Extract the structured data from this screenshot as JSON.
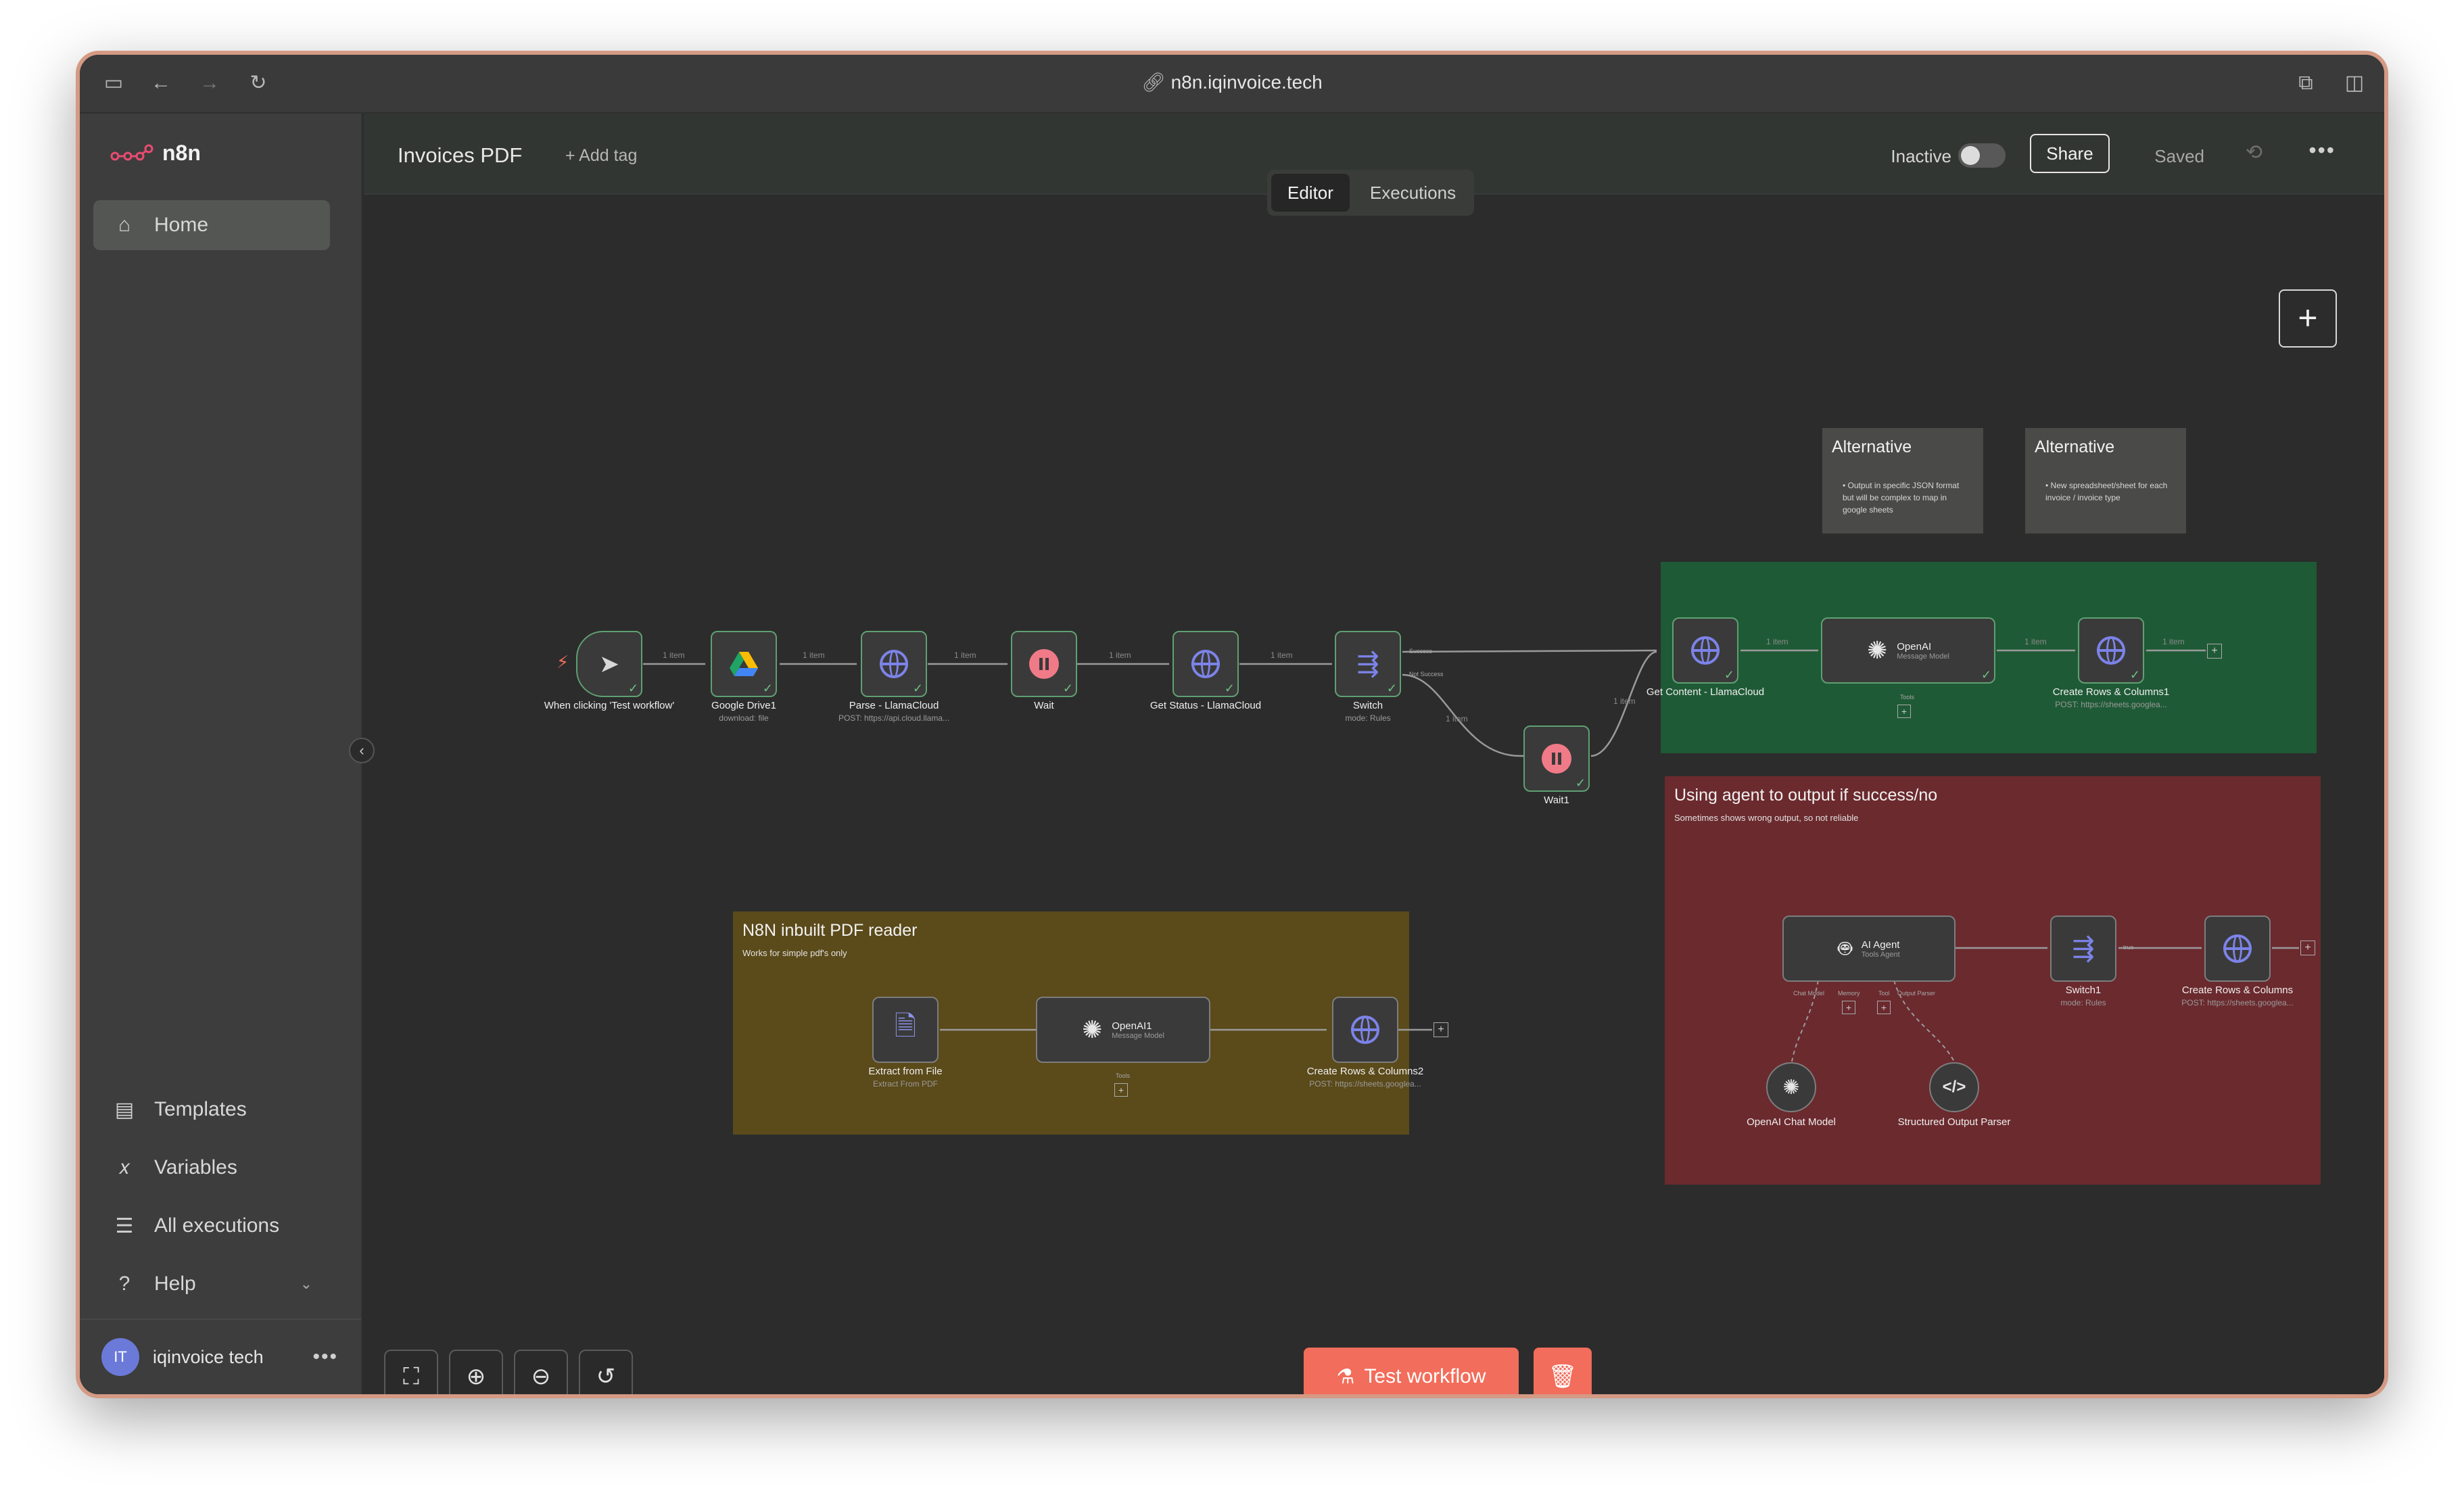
{
  "browser": {
    "url": "n8n.iqinvoice.tech"
  },
  "sidebar": {
    "brand": "n8n",
    "items": [
      {
        "label": "Home",
        "icon": "home-icon"
      },
      {
        "label": "Templates",
        "icon": "templates-icon"
      },
      {
        "label": "Variables",
        "icon": "variables-icon"
      },
      {
        "label": "All executions",
        "icon": "executions-icon"
      },
      {
        "label": "Help",
        "icon": "help-icon"
      }
    ],
    "user": {
      "initials": "IT",
      "name": "iqinvoice tech"
    }
  },
  "header": {
    "title": "Invoices PDF",
    "add_tag": "+ Add tag",
    "status_label": "Inactive",
    "share": "Share",
    "saved": "Saved",
    "tabs": [
      "Editor",
      "Executions"
    ]
  },
  "stickies": [
    {
      "title": "Alternative",
      "bullet": "Output in specific JSON format but will be complex to map in google sheets",
      "color": "#4a4a48"
    },
    {
      "title": "Alternative",
      "bullet": "New spreadsheet/sheet for each invoice / invoice type",
      "color": "#4a4a48"
    },
    {
      "title": "N8N inbuilt PDF reader",
      "sub": "Works for simple pdf's only",
      "color": "#5b4a1a"
    },
    {
      "title": "Using agent to output if success/no",
      "sub": "Sometimes shows wrong output, so not reliable",
      "color": "#6b2a2e"
    },
    {
      "title": "",
      "color": "#1f5a36"
    }
  ],
  "nodes": {
    "trigger": {
      "label": "When clicking 'Test workflow'"
    },
    "gdrive": {
      "label": "Google Drive1",
      "sub": "download: file"
    },
    "parse": {
      "label": "Parse - LlamaCloud",
      "sub": "POST: https://api.cloud.llama..."
    },
    "wait": {
      "label": "Wait"
    },
    "getstatus": {
      "label": "Get Status - LlamaCloud"
    },
    "switch": {
      "label": "Switch",
      "sub": "mode: Rules",
      "out1": "Success",
      "out2": "Not Success"
    },
    "wait1": {
      "label": "Wait1"
    },
    "getcontent": {
      "label": "Get Content - LlamaCloud"
    },
    "openai": {
      "label": "OpenAI",
      "sub": "Message Model",
      "port": "Tools"
    },
    "createrows1": {
      "label": "Create Rows & Columns1",
      "sub": "POST: https://sheets.googlea..."
    },
    "extract": {
      "label": "Extract from File",
      "sub": "Extract From PDF"
    },
    "openai1": {
      "label": "OpenAI1",
      "sub": "Message Model",
      "port": "Tools"
    },
    "createrows2": {
      "label": "Create Rows & Columns2",
      "sub": "POST: https://sheets.googlea..."
    },
    "agent": {
      "label": "AI Agent",
      "sub": "Tools Agent",
      "ports": [
        "Chat Model",
        "Memory",
        "Tool",
        "Output Parser"
      ]
    },
    "switch1": {
      "label": "Switch1",
      "sub": "mode: Rules",
      "out": "true"
    },
    "createrows": {
      "label": "Create Rows & Columns",
      "sub": "POST: https://sheets.googlea..."
    },
    "chatmodel": {
      "label": "OpenAI Chat Model"
    },
    "parser": {
      "label": "Structured Output Parser"
    }
  },
  "edge_label": "1 item",
  "actions": {
    "test_workflow": "Test workflow"
  },
  "colors": {
    "accent": "#f26d5b",
    "success": "#6ebf83",
    "http": "#7c83e8",
    "wait": "#f07a87"
  }
}
